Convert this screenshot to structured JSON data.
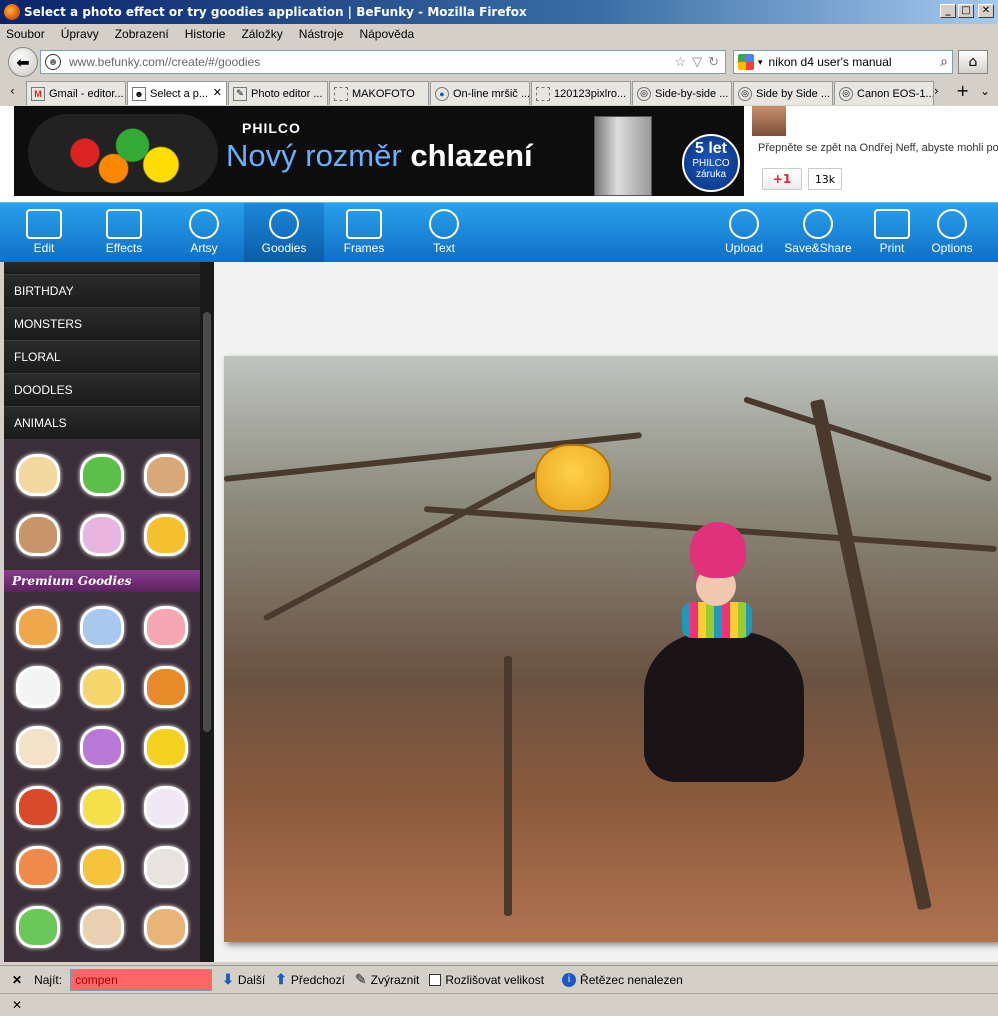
{
  "window": {
    "title": "Select a photo effect or try goodies application | BeFunky - Mozilla Firefox",
    "buttons": [
      "_",
      "□",
      "✕"
    ]
  },
  "menu": [
    "Soubor",
    "Úpravy",
    "Zobrazení",
    "Historie",
    "Záložky",
    "Nástroje",
    "Nápověda"
  ],
  "nav": {
    "url": "www.befunky.com//create/#/goodies",
    "search_value": "nikon d4 user's manual"
  },
  "tabs": [
    {
      "label": "Gmail - editor...",
      "icon": "M"
    },
    {
      "label": "Select a p...",
      "icon": "☻",
      "active": true,
      "close": "✕"
    },
    {
      "label": "Photo editor ...",
      "icon": "✎"
    },
    {
      "label": "MAKOFOTO",
      "icon": ""
    },
    {
      "label": "On-line mršič ...",
      "icon": "●"
    },
    {
      "label": "120123pixlro...",
      "icon": ""
    },
    {
      "label": "Side-by-side ...",
      "icon": "◎"
    },
    {
      "label": "Side by Side ...",
      "icon": "◎"
    },
    {
      "label": "Canon EOS-1...",
      "icon": "◎"
    }
  ],
  "tab_controls": {
    "left": "‹",
    "right": "›",
    "new": "+",
    "menu": "⌄"
  },
  "ad": {
    "brand": "PHILCO",
    "headline_light": "Nový rozměr",
    "headline_bold": "chlazení",
    "badge_big": "5 let",
    "badge_brand": "PHILCO",
    "badge_small": "záruka"
  },
  "social": {
    "text": "Přepněte se zpět na Ondřej Neff, abyste mohli po",
    "plus_label": "+1",
    "count": "13k"
  },
  "toolbar": {
    "left": [
      "Edit",
      "Effects",
      "Artsy",
      "Goodies",
      "Frames",
      "Text"
    ],
    "right": [
      "Upload",
      "Save&Share",
      "Print",
      "Options"
    ],
    "active": "Goodies"
  },
  "categories": [
    "BIRTHDAY",
    "MONSTERS",
    "FLORAL",
    "DOODLES",
    "ANIMALS"
  ],
  "goodies_free_colors": [
    "#f3d9a0",
    "#5cbf4a",
    "#d8a878",
    "#c8946a",
    "#e8b4e0",
    "#f5c12e"
  ],
  "premium_label": "Premium Goodies",
  "goodies_premium_colors": [
    "#f0a64a",
    "#a8c8ee",
    "#f5a8b4",
    "#f4f4f4",
    "#f5d66a",
    "#e88a2a",
    "#f2e2c8",
    "#b878d8",
    "#f5d220",
    "#d84a2a",
    "#f6e04a",
    "#f0e8f4",
    "#f08a4a",
    "#f5c43a",
    "#e8e2e0",
    "#6ac858",
    "#e8d0b0",
    "#e8b478"
  ],
  "findbar": {
    "close": "✕",
    "label": "Najít:",
    "value": "compen",
    "next": "Další",
    "prev": "Předchozí",
    "highlight": "Zvýraznit",
    "match_case": "Rozlišovat velikost",
    "status": "Řetězec nenalezen"
  },
  "statusbar_close": "✕"
}
